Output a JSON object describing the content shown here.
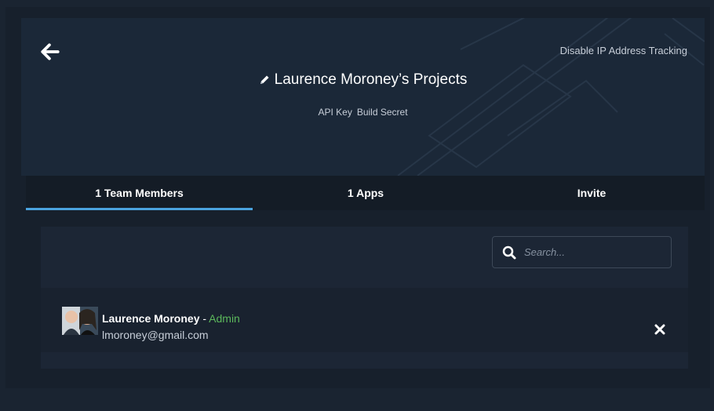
{
  "header": {
    "disable_tracking_label": "Disable IP Address Tracking",
    "title": "Laurence Moroney’s Projects",
    "api_key_label": "API Key",
    "build_secret_label": "Build Secret",
    "back_icon": "arrow-left-icon",
    "edit_icon": "pencil-icon"
  },
  "tabs": [
    {
      "label": "1 Team Members",
      "active": true
    },
    {
      "label": "1 Apps",
      "active": false
    },
    {
      "label": "Invite",
      "active": false
    }
  ],
  "search": {
    "placeholder": "Search...",
    "icon": "search-icon"
  },
  "members": [
    {
      "name": "Laurence Moroney",
      "separator": " - ",
      "role": "Admin",
      "email": "lmoroney@gmail.com",
      "remove_icon": "close-icon"
    }
  ],
  "colors": {
    "accent": "#4aa3df",
    "admin": "#5cb85c",
    "background": "#1a2431"
  }
}
